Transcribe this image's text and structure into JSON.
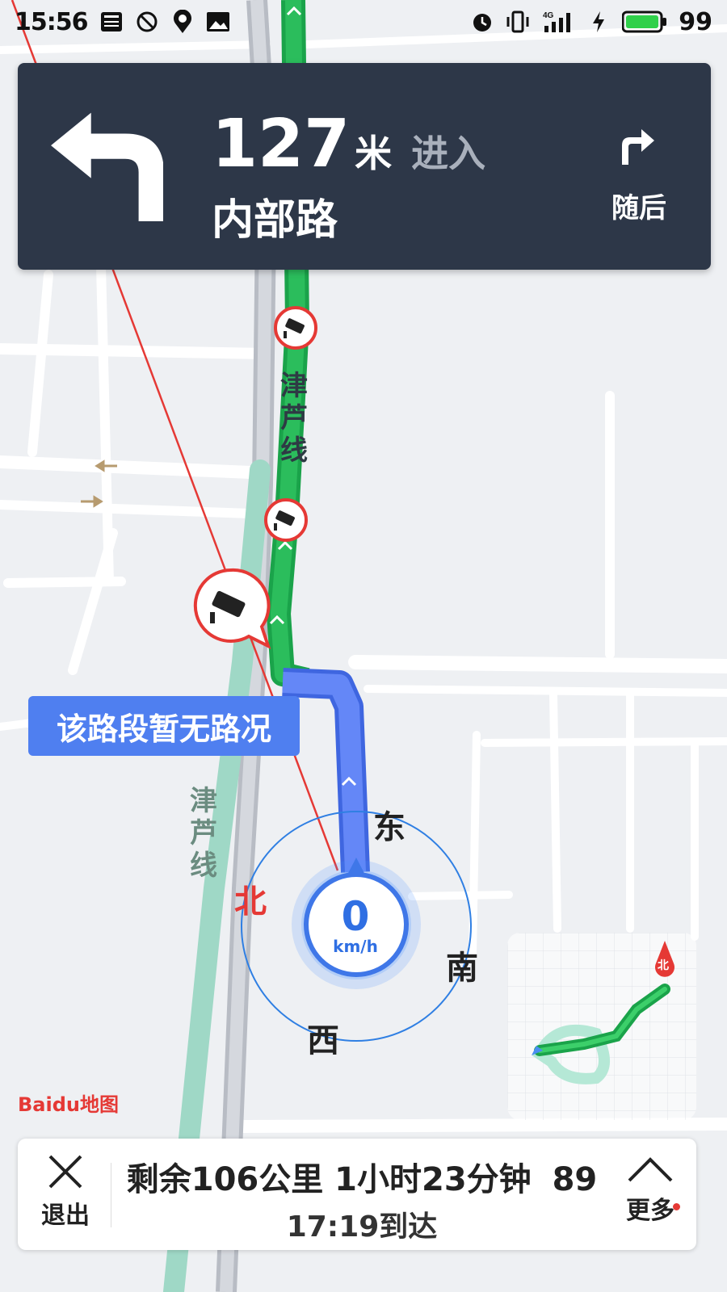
{
  "status_bar": {
    "time": "15:56",
    "left_icons": [
      "news-icon",
      "do-not-disturb-icon",
      "du-location-icon",
      "gallery-icon"
    ],
    "right_icons": [
      "alarm-icon",
      "vibrate-icon",
      "signal-4g-icon",
      "charging-icon",
      "battery-icon"
    ],
    "network": "4G",
    "battery_level": "99"
  },
  "guidance": {
    "distance": "127",
    "unit": "米",
    "action": "进入",
    "road": "内部路",
    "turn_icon": "turn-left-icon",
    "next_turn_icon": "turn-right-icon",
    "next_label": "随后"
  },
  "map": {
    "traffic_tip": "该路段暂无路况",
    "road_name_1": "津芦线",
    "road_name_2": "津芦线",
    "compass": {
      "north": "北",
      "east": "东",
      "south": "南",
      "west": "西"
    },
    "speed": "0",
    "speed_unit": "km/h",
    "minimap_north": "北",
    "logo": "Baidu地图",
    "colors": {
      "route_green": "#1aa34a",
      "route_blue": "#5b7ff5",
      "route_light": "#9fd8c6",
      "card_bg": "#2d3748",
      "north_red": "#e53935"
    }
  },
  "bottom_bar": {
    "exit_label": "退出",
    "remaining": "剩余106公里 1小时23分钟",
    "lights": "89",
    "arrival": "17:19到达",
    "more_label": "更多"
  }
}
